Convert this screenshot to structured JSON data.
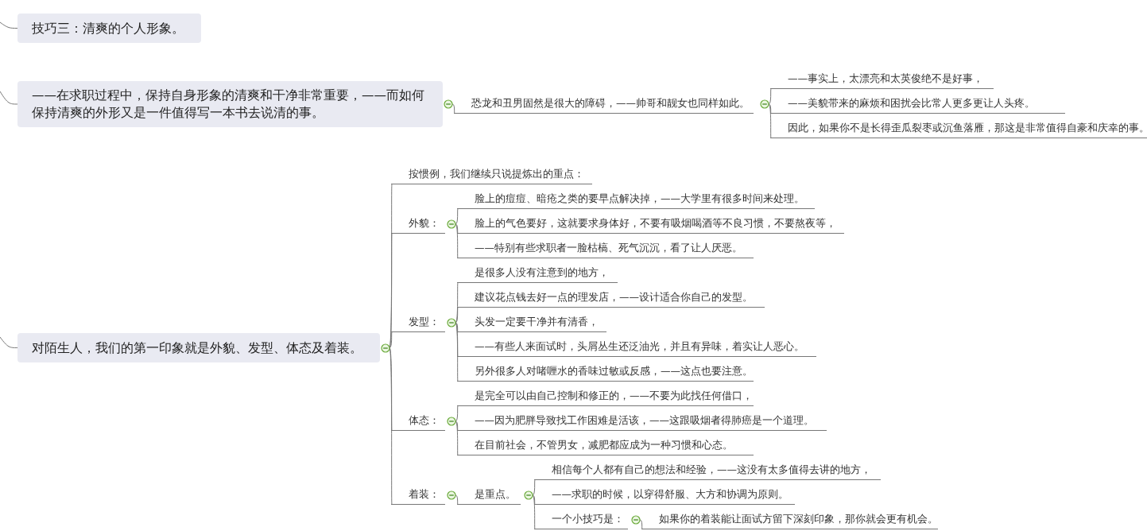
{
  "topics": [
    {
      "text": "技巧三：清爽的个人形象。"
    },
    {
      "text": "——在求职过程中，保持自身形象的清爽和干净非常重要，——而如何保持清爽的外形又是一件值得写一本书去说清的事。",
      "expanded": true,
      "children": [
        {
          "text": "恐龙和丑男固然是很大的障碍，——帅哥和靓女也同样如此。",
          "expanded": true,
          "children": [
            {
              "text": "——事实上，太漂亮和太英俊绝不是好事，"
            },
            {
              "text": "——美貌带来的麻烦和困扰会比常人更多更让人头疼。"
            },
            {
              "text": "因此，如果你不是长得歪瓜裂枣或沉鱼落雁，那这是非常值得自豪和庆幸的事。"
            }
          ]
        }
      ]
    },
    {
      "text": "对陌生人，我们的第一印象就是外貌、发型、体态及着装。",
      "expanded": true,
      "children": [
        {
          "text": "按惯例，我们继续只说提炼出的重点："
        },
        {
          "text": "外貌：",
          "expanded": true,
          "children": [
            {
              "text": "脸上的痘痘、暗疮之类的要早点解决掉，——大学里有很多时间来处理。"
            },
            {
              "text": "脸上的气色要好，这就要求身体好，不要有吸烟喝酒等不良习惯，不要熬夜等，"
            },
            {
              "text": "——特别有些求职者一脸枯槁、死气沉沉，看了让人厌恶。"
            }
          ]
        },
        {
          "text": "发型：",
          "expanded": true,
          "children": [
            {
              "text": "是很多人没有注意到的地方，"
            },
            {
              "text": "建议花点钱去好一点的理发店，——设计适合你自己的发型。"
            },
            {
              "text": "头发一定要干净并有清香，"
            },
            {
              "text": "——有些人来面试时，头屑丛生还泛油光，并且有异味，着实让人恶心。"
            },
            {
              "text": "另外很多人对啫喱水的香味过敏或反感，——这点也要注意。"
            }
          ]
        },
        {
          "text": "体态：",
          "expanded": true,
          "children": [
            {
              "text": "是完全可以由自己控制和修正的，——不要为此找任何借口，"
            },
            {
              "text": "——因为肥胖导致找工作困难是活该，——这跟吸烟者得肺癌是一个道理。"
            },
            {
              "text": "在目前社会，不管男女，减肥都应成为一种习惯和心态。"
            }
          ]
        },
        {
          "text": "着装：",
          "expanded": true,
          "children": [
            {
              "text": "是重点。",
              "expanded": true,
              "children": [
                {
                  "text": "相信每个人都有自己的想法和经验，——这没有太多值得去讲的地方，"
                },
                {
                  "text": "——求职的时候，以穿得舒服、大方和协调为原则。"
                },
                {
                  "text": "一个小技巧是：",
                  "expanded": true,
                  "children": [
                    {
                      "text": "如果你的着装能让面试方留下深刻印象，那你就会更有机会。"
                    }
                  ]
                }
              ]
            }
          ]
        }
      ]
    }
  ]
}
